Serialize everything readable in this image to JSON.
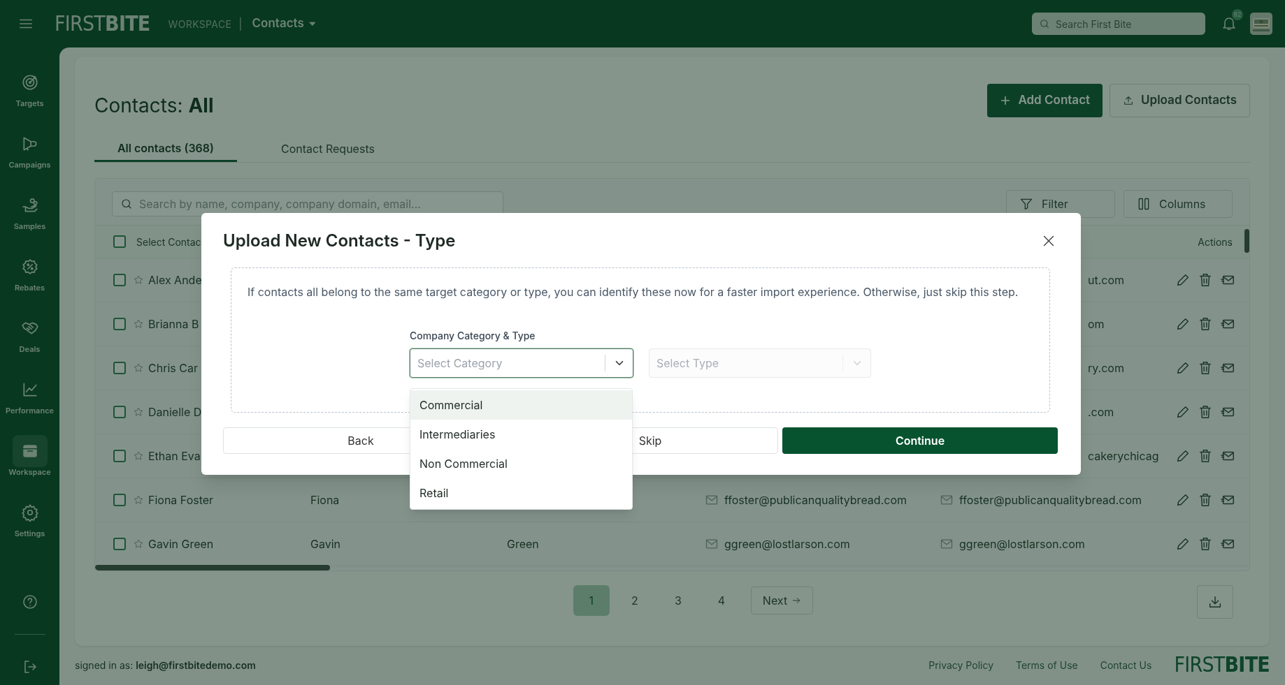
{
  "top_bar": {
    "logo": "FIRST**BITE**",
    "section": "WORKSPACE",
    "separator": "|",
    "page_menu": "Contacts",
    "search": {
      "placeholder": "Search First Bite"
    },
    "notification_count": "82"
  },
  "sidebar": {
    "items": [
      {
        "label": "Targets",
        "kind": "target",
        "selected": false
      },
      {
        "label": "Campaigns",
        "kind": "megaphone",
        "selected": false
      },
      {
        "label": "Samples",
        "kind": "hand",
        "selected": false
      },
      {
        "label": "Rebates",
        "kind": "percent",
        "selected": false
      },
      {
        "label": "Deals",
        "kind": "handshake",
        "selected": false
      },
      {
        "label": "Performance",
        "kind": "chart",
        "selected": false
      },
      {
        "label": "Workspace",
        "kind": "archive",
        "selected": true
      },
      {
        "label": "Settings",
        "kind": "gear",
        "selected": false
      }
    ]
  },
  "page": {
    "title": "Contacts: **All**",
    "buttons": [
      {
        "label": "Add Contact",
        "kind": "primary"
      },
      {
        "label": "Upload Contacts",
        "kind": "secondary"
      }
    ],
    "tabs": [
      {
        "label": "All contacts (368)",
        "selected": true
      },
      {
        "label": "Contact Requests",
        "selected": false
      }
    ]
  },
  "table": {
    "search": {
      "placeholder": "Search by name, company, company domain, email..."
    },
    "toolbar": [
      {
        "label": "Filter",
        "kind": "filter"
      },
      {
        "label": "Columns",
        "kind": "columns"
      }
    ],
    "select_all": {
      "label": "Select Contac",
      "checked": false
    },
    "actions_column": "Actions",
    "rows": [
      {
        "name": "Alex Ande",
        "email_2": "ut.com",
        "checked": false,
        "starred": false
      },
      {
        "name": "Brianna B",
        "email_2": "om",
        "checked": false,
        "starred": false
      },
      {
        "name": "Chris Car",
        "email_2": "ry.com",
        "checked": false,
        "starred": false
      },
      {
        "name": "Danielle D",
        "email_2": ".com",
        "checked": false,
        "starred": false
      },
      {
        "name": "Ethan Eva",
        "email_2": "cakerychicag",
        "checked": false,
        "starred": false
      },
      {
        "name": "Fiona Foster",
        "first_name": "Fiona",
        "email": "ffoster@publicanqualitybread.com",
        "email_2": "ffoster@publicanqualitybread.com",
        "checked": false,
        "starred": false
      },
      {
        "name": "Gavin Green",
        "first_name": "Gavin",
        "last_name": "Green",
        "email": "ggreen@lostlarson.com",
        "email_2": "ggreen@lostlarson.com",
        "checked": false,
        "starred": false
      }
    ]
  },
  "pagination": {
    "pages": [
      {
        "label": "1",
        "selected": true
      },
      {
        "label": "2",
        "selected": false
      },
      {
        "label": "3",
        "selected": false
      },
      {
        "label": "4",
        "selected": false
      }
    ],
    "next": "Next"
  },
  "footer": {
    "signed_in": "signed in as: **leigh@firstbitedemo.com**",
    "links": [
      "Privacy Policy",
      "Terms of Use",
      "Contact Us"
    ],
    "logo": "FIRST**BITE**"
  },
  "modal": {
    "title": "Upload New Contacts - Type",
    "description": "If contacts all belong to the same target category or type, you can identify these now for a faster import experience. Otherwise, just skip this step.",
    "field_label": "Company Category & Type",
    "category_select": {
      "placeholder": "Select Category",
      "expanded": true
    },
    "type_select": {
      "placeholder": "Select Type",
      "disabled": true
    },
    "options": [
      {
        "label": "Commercial",
        "selected": true
      },
      {
        "label": "Intermediaries",
        "selected": false
      },
      {
        "label": "Non Commercial",
        "selected": false
      },
      {
        "label": "Retail",
        "selected": false
      }
    ],
    "buttons": [
      {
        "label": "Back",
        "kind": "secondary"
      },
      {
        "label": "Skip",
        "kind": "secondary"
      },
      {
        "label": "Continue",
        "kind": "primary"
      }
    ]
  }
}
